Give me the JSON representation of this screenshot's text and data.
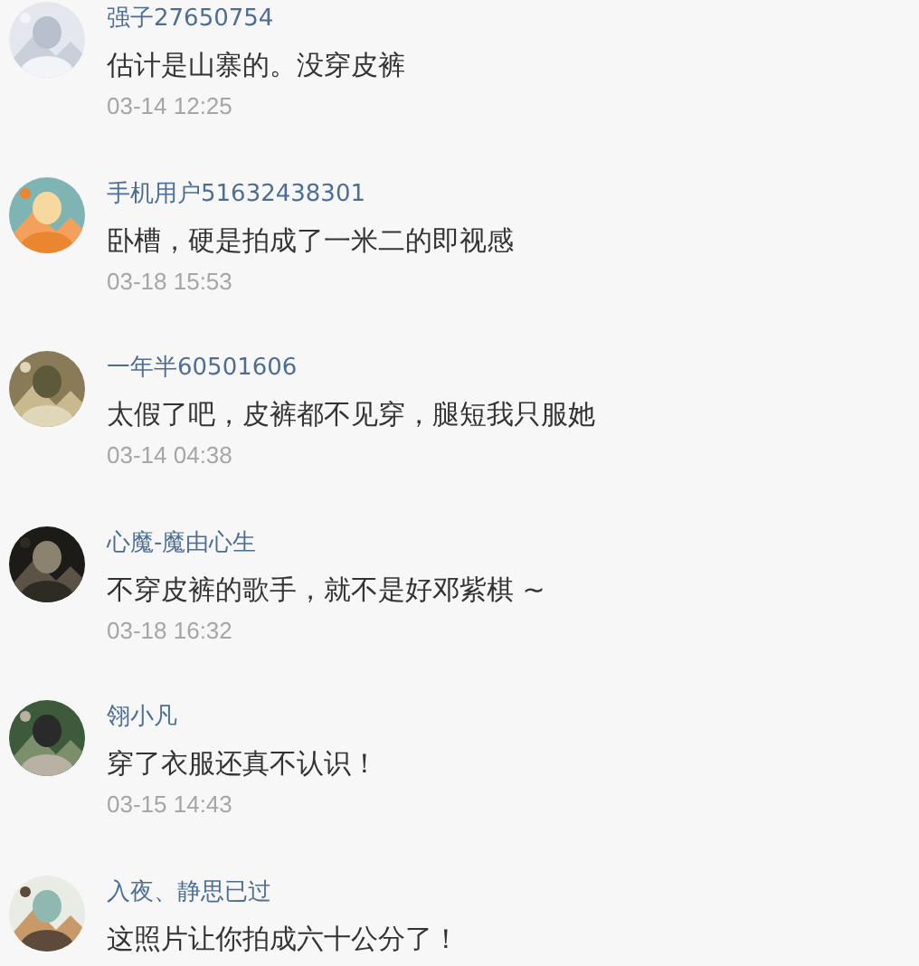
{
  "comments": [
    {
      "user": "强子27650754",
      "text": "估计是山寨的。没穿皮裤",
      "time": "03-14 12:25"
    },
    {
      "user": "手机用户51632438301",
      "text": "卧槽，硬是拍成了一米二的即视感",
      "time": "03-18 15:53"
    },
    {
      "user": "一年半60501606",
      "text": "太假了吧，皮裤都不见穿，腿短我只服她",
      "time": "03-14 04:38"
    },
    {
      "user": "心魔-魔由心生",
      "text": "不穿皮裤的歌手，就不是好邓紫棋 ~",
      "time": "03-18 16:32"
    },
    {
      "user": "翎小凡",
      "text": "穿了衣服还真不认识！",
      "time": "03-15 14:43"
    },
    {
      "user": "入夜、静思已过",
      "text": "这照片让你拍成六十公分了！"
    }
  ]
}
